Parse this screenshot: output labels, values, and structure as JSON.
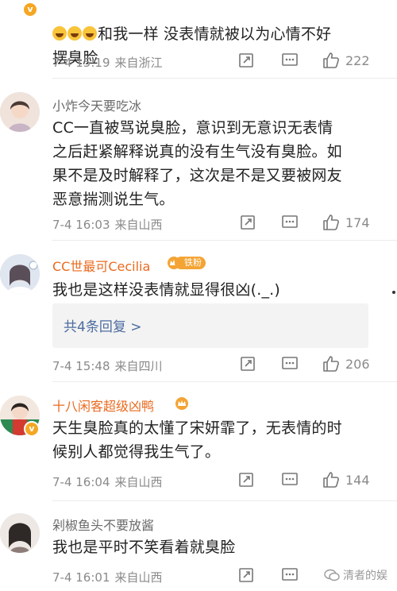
{
  "comments": [
    {
      "username": "",
      "emoji_prefix_count": 3,
      "text": "和我一样 没表情就被以为心情不好\n摆臭脸",
      "date": "7-4 15:19",
      "source": "来自浙江",
      "likes": "222",
      "verified": true
    },
    {
      "username": "小炸今天要吃冰",
      "text": "CC一直被骂说臭脸，意识到无意识无表情\n之后赶紧解释说真的没有生气没有臭脸。如\n果不是及时解释了，这次是不是又要被网友\n恶意揣测说生气。",
      "date": "7-4 16:03",
      "source": "来自山西",
      "likes": "174"
    },
    {
      "username": "CC世最可Cecilia",
      "badge": "铁粉",
      "text": "我也是这样没表情就显得很凶(._.)",
      "replies_link": "共4条回复 >",
      "date": "7-4 15:48",
      "source": "来自四川",
      "likes": "206"
    },
    {
      "username": "十八闲客超级凶鸭",
      "text": "天生臭脸真的太懂了宋妍霏了，无表情的时\n候别人都觉得我生气了。",
      "date": "7-4 16:04",
      "source": "来自山西",
      "likes": "144",
      "verified": true
    },
    {
      "username": "剁椒鱼头不要放酱",
      "text": "我也是平时不笑看着就臭脸",
      "date": "7-4 16:01",
      "source": "来自山西"
    }
  ],
  "watermark": "清者的娱",
  "colors": {
    "orange_name": "#ea6a1f",
    "link_blue": "#4d6ca0",
    "badge_orange": "#f4a434"
  }
}
